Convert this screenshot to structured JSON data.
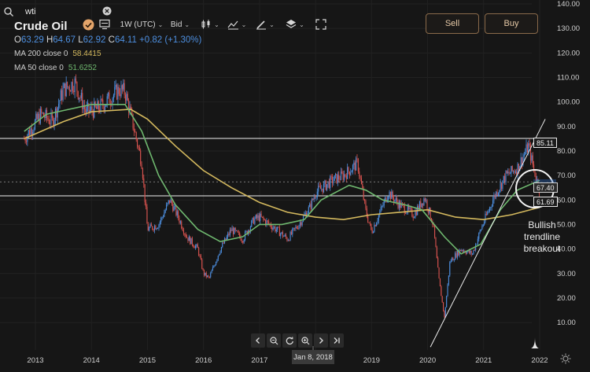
{
  "search": {
    "value": "wti",
    "icon": "search-icon",
    "clear_icon": "close-circle-icon"
  },
  "instrument": {
    "name": "Crude Oil"
  },
  "ohlc": {
    "o_label": "O",
    "o_value": "63.29",
    "h_label": "H",
    "h_value": "64.67",
    "l_label": "L",
    "l_value": "62.92",
    "c_label": "C",
    "c_value": "64.11",
    "change": "+0.82 (+1.30%)"
  },
  "indicators": [
    {
      "label": "MA 200 close 0",
      "value": "58.4415",
      "color": "#d4b95e"
    },
    {
      "label": "MA 50 close 0",
      "value": "51.6252",
      "color": "#6fb86f"
    }
  ],
  "toolbar": {
    "interval": "1W (UTC)",
    "price_type": "Bid",
    "icons": [
      "check-circle-icon",
      "monitor-icon",
      "candles-icon",
      "indicators-icon",
      "draw-icon",
      "layers-icon",
      "fullscreen-icon"
    ]
  },
  "trade": {
    "sell": "Sell",
    "buy": "Buy"
  },
  "navigation": {
    "icons": [
      "chevron-left-icon",
      "zoom-out-icon",
      "reset-icon",
      "zoom-in-icon",
      "chevron-right-icon",
      "skip-end-icon"
    ]
  },
  "crosshair_date": "Jan 8, 2018",
  "price_labels": {
    "upper": "85.11",
    "current": "67.40",
    "lower": "61.69",
    "partial": "70.00"
  },
  "annotation": {
    "line1": "Bullish",
    "line2": "trendline",
    "line3": "breakout"
  },
  "colors": {
    "background": "#161616",
    "up": "#4d8fe0",
    "down": "#d9534f",
    "ma200": "#d4b95e",
    "ma50": "#6fb86f",
    "accent": "#e6c9a6"
  },
  "chart_data": {
    "type": "candlestick",
    "x_ticks": [
      "2013",
      "2014",
      "2015",
      "2016",
      "2017",
      "2018",
      "2019",
      "2020",
      "2021",
      "2022"
    ],
    "y_ticks": [
      "10.00",
      "20.00",
      "30.00",
      "40.00",
      "50.00",
      "60.00",
      "70.00",
      "80.00",
      "90.00",
      "100.00",
      "110.00",
      "120.00",
      "130.00",
      "140.00"
    ],
    "y_range": [
      2,
      140
    ],
    "horizontal_levels": [
      85.11,
      61.69
    ],
    "current_price": 67.4,
    "price_path": [
      [
        2012.8,
        85
      ],
      [
        2013.1,
        95
      ],
      [
        2013.3,
        92
      ],
      [
        2013.5,
        105
      ],
      [
        2013.7,
        108
      ],
      [
        2013.9,
        96
      ],
      [
        2014.1,
        97
      ],
      [
        2014.3,
        101
      ],
      [
        2014.5,
        105
      ],
      [
        2014.6,
        104
      ],
      [
        2014.7,
        95
      ],
      [
        2014.9,
        75
      ],
      [
        2015.0,
        48
      ],
      [
        2015.2,
        50
      ],
      [
        2015.4,
        60
      ],
      [
        2015.55,
        53
      ],
      [
        2015.7,
        45
      ],
      [
        2015.9,
        40
      ],
      [
        2016.0,
        30
      ],
      [
        2016.1,
        28
      ],
      [
        2016.3,
        40
      ],
      [
        2016.5,
        48
      ],
      [
        2016.7,
        44
      ],
      [
        2016.9,
        52
      ],
      [
        2017.0,
        53
      ],
      [
        2017.3,
        48
      ],
      [
        2017.5,
        44
      ],
      [
        2017.7,
        50
      ],
      [
        2017.9,
        57
      ],
      [
        2018.0,
        63
      ],
      [
        2018.3,
        68
      ],
      [
        2018.5,
        70
      ],
      [
        2018.75,
        75
      ],
      [
        2018.9,
        55
      ],
      [
        2019.0,
        47
      ],
      [
        2019.3,
        63
      ],
      [
        2019.5,
        58
      ],
      [
        2019.75,
        54
      ],
      [
        2019.95,
        61
      ],
      [
        2020.1,
        50
      ],
      [
        2020.2,
        28
      ],
      [
        2020.3,
        12
      ],
      [
        2020.4,
        35
      ],
      [
        2020.6,
        40
      ],
      [
        2020.8,
        38
      ],
      [
        2020.95,
        48
      ],
      [
        2021.2,
        62
      ],
      [
        2021.4,
        70
      ],
      [
        2021.6,
        73
      ],
      [
        2021.8,
        82
      ],
      [
        2021.9,
        72
      ],
      [
        2022.0,
        64
      ]
    ],
    "ma200": [
      [
        2012.8,
        85
      ],
      [
        2013.5,
        92
      ],
      [
        2014.0,
        96
      ],
      [
        2014.7,
        97
      ],
      [
        2015.0,
        93
      ],
      [
        2015.5,
        82
      ],
      [
        2016.0,
        72
      ],
      [
        2016.5,
        65
      ],
      [
        2017.0,
        59
      ],
      [
        2017.5,
        55
      ],
      [
        2018.0,
        53
      ],
      [
        2018.5,
        52
      ],
      [
        2019.0,
        54
      ],
      [
        2019.5,
        55
      ],
      [
        2020.0,
        56
      ],
      [
        2020.5,
        53
      ],
      [
        2021.0,
        52
      ],
      [
        2021.5,
        54
      ],
      [
        2022.0,
        57
      ]
    ],
    "ma50": [
      [
        2012.8,
        88
      ],
      [
        2013.2,
        95
      ],
      [
        2013.6,
        97
      ],
      [
        2014.0,
        99
      ],
      [
        2014.6,
        99
      ],
      [
        2014.9,
        88
      ],
      [
        2015.2,
        70
      ],
      [
        2015.5,
        58
      ],
      [
        2015.9,
        48
      ],
      [
        2016.3,
        43
      ],
      [
        2016.7,
        45
      ],
      [
        2017.0,
        50
      ],
      [
        2017.4,
        50
      ],
      [
        2017.8,
        52
      ],
      [
        2018.1,
        60
      ],
      [
        2018.6,
        66
      ],
      [
        2018.9,
        64
      ],
      [
        2019.2,
        60
      ],
      [
        2019.6,
        58
      ],
      [
        2019.9,
        56
      ],
      [
        2020.3,
        45
      ],
      [
        2020.6,
        38
      ],
      [
        2020.95,
        42
      ],
      [
        2021.3,
        56
      ],
      [
        2021.6,
        64
      ],
      [
        2022.0,
        68
      ]
    ],
    "trendline": [
      [
        2020.05,
        0
      ],
      [
        2022.1,
        93
      ]
    ]
  }
}
